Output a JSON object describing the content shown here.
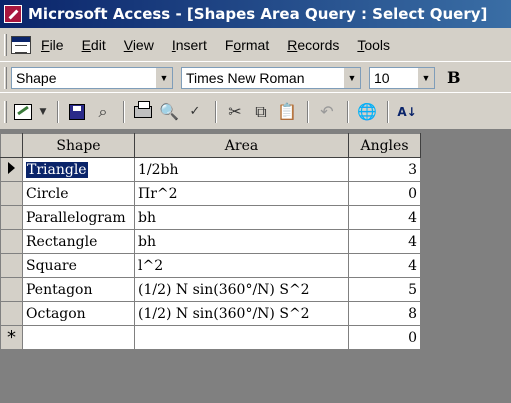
{
  "window": {
    "title": "Microsoft Access - [Shapes Area Query : Select Query]"
  },
  "menu": {
    "items": [
      {
        "u": "F",
        "rest": "ile"
      },
      {
        "u": "E",
        "rest": "dit"
      },
      {
        "u": "V",
        "rest": "iew"
      },
      {
        "u": "I",
        "rest": "nsert"
      },
      {
        "pre": "F",
        "u": "o",
        "rest": "rmat"
      },
      {
        "u": "R",
        "rest": "ecords"
      },
      {
        "u": "T",
        "rest": "ools"
      }
    ]
  },
  "format_toolbar": {
    "object_combo": "Shape",
    "font_combo": "Times New Roman",
    "size_combo": "10",
    "bold_label": "B"
  },
  "datasheet": {
    "columns": [
      "Shape",
      "Area",
      "Angles"
    ],
    "rows": [
      {
        "shape": "Triangle",
        "area": "1/2bh",
        "angles": "3"
      },
      {
        "shape": "Circle",
        "area": "Πr^2",
        "angles": "0"
      },
      {
        "shape": "Parallelogram",
        "area": "bh",
        "angles": "4"
      },
      {
        "shape": "Rectangle",
        "area": "bh",
        "angles": "4"
      },
      {
        "shape": "Square",
        "area": "l^2",
        "angles": "4"
      },
      {
        "shape": "Pentagon",
        "area": "(1/2) N sin(360°/N) S^2",
        "angles": "5"
      },
      {
        "shape": "Octagon",
        "area": "(1/2) N sin(360°/N) S^2",
        "angles": "8"
      }
    ],
    "new_row": {
      "marker": "*",
      "angles": "0"
    }
  },
  "icons": {
    "title": "access-app-icon",
    "menu": "database-window-icon",
    "toolbar": [
      "view-icon",
      "save-icon",
      "find-icon",
      "print-icon",
      "print-preview-icon",
      "spelling-icon",
      "cut-icon",
      "copy-icon",
      "paste-icon",
      "undo-icon",
      "insert-hyperlink-icon",
      "sort-ascending-icon"
    ]
  }
}
